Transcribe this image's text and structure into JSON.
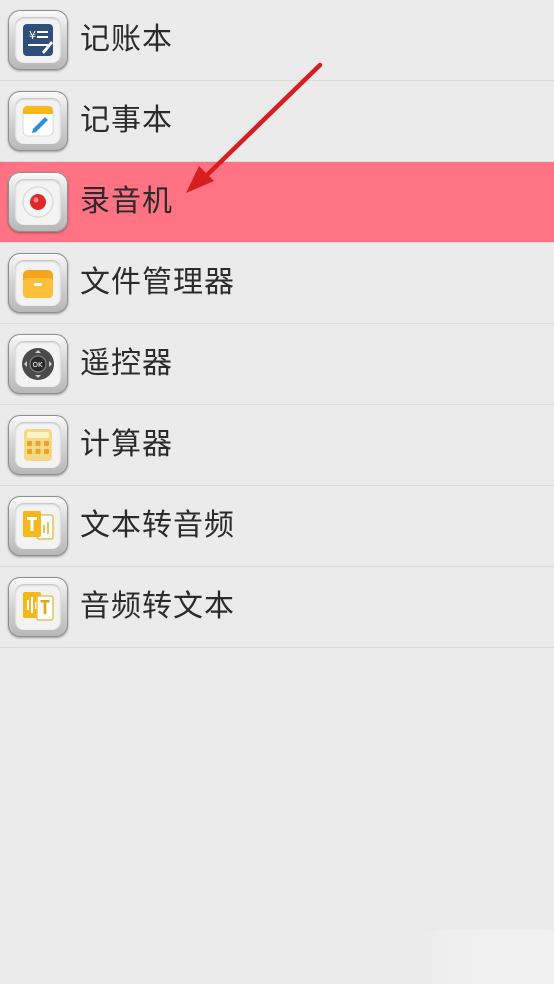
{
  "menu": {
    "items": [
      {
        "label": "记账本",
        "icon": "ledger-icon"
      },
      {
        "label": "记事本",
        "icon": "notepad-icon"
      },
      {
        "label": "录音机",
        "icon": "recorder-icon"
      },
      {
        "label": "文件管理器",
        "icon": "file-manager-icon"
      },
      {
        "label": "遥控器",
        "icon": "remote-control-icon"
      },
      {
        "label": "计算器",
        "icon": "calculator-icon"
      },
      {
        "label": "文本转音频",
        "icon": "text-to-audio-icon"
      },
      {
        "label": "音频转文本",
        "icon": "audio-to-text-icon"
      }
    ],
    "selected_index": 2
  },
  "colors": {
    "background": "#ebebeb",
    "selected_row": "#ff7385",
    "divider": "#d9d9d9",
    "label_text": "#2b2b2b",
    "annotation_arrow": "#d81e1e"
  },
  "annotation": {
    "type": "arrow",
    "points_to": "录音机"
  }
}
